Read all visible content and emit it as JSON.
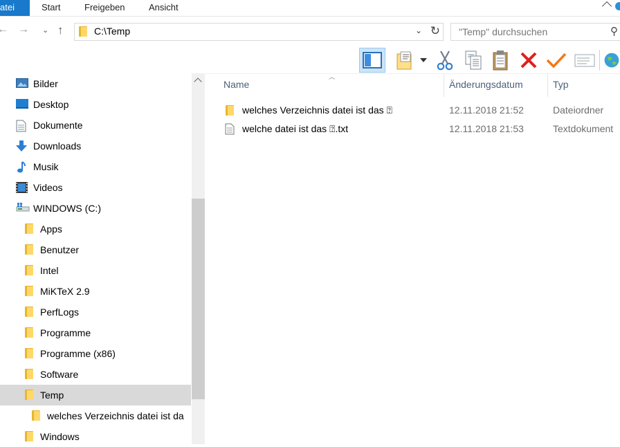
{
  "ribbon": {
    "tabs": [
      "Datei",
      "Start",
      "Freigeben",
      "Ansicht"
    ]
  },
  "address": {
    "path": "C:\\Temp",
    "search_placeholder": "\"Temp\" durchsuchen"
  },
  "toolbar": {
    "buttons": [
      "navigation-pane-icon",
      "properties-icon",
      "cut-icon",
      "copy-icon",
      "paste-icon",
      "delete-icon",
      "check-icon",
      "mail-icon",
      "globe-icon"
    ],
    "colors": {
      "active": "#cce4f7",
      "delete": "#e0201b",
      "check": "#f07a1b"
    }
  },
  "sidebar": {
    "items": [
      {
        "label": "Bilder",
        "icon": "pictures-icon"
      },
      {
        "label": "Desktop",
        "icon": "desktop-icon"
      },
      {
        "label": "Dokumente",
        "icon": "documents-icon"
      },
      {
        "label": "Downloads",
        "icon": "downloads-icon"
      },
      {
        "label": "Musik",
        "icon": "music-icon"
      },
      {
        "label": "Videos",
        "icon": "videos-icon"
      },
      {
        "label": "WINDOWS (C:)",
        "icon": "drive-icon"
      },
      {
        "label": "Apps",
        "icon": "folder-icon"
      },
      {
        "label": "Benutzer",
        "icon": "folder-icon"
      },
      {
        "label": "Intel",
        "icon": "folder-icon"
      },
      {
        "label": "MiKTeX 2.9",
        "icon": "folder-icon"
      },
      {
        "label": "PerfLogs",
        "icon": "folder-icon"
      },
      {
        "label": "Programme",
        "icon": "folder-icon"
      },
      {
        "label": "Programme (x86)",
        "icon": "folder-icon"
      },
      {
        "label": "Software",
        "icon": "folder-icon"
      },
      {
        "label": "Temp",
        "icon": "folder-icon",
        "selected": true
      },
      {
        "label": "welches Verzeichnis datei ist da",
        "icon": "folder-icon"
      },
      {
        "label": "Windows",
        "icon": "folder-icon"
      }
    ]
  },
  "content": {
    "columns": {
      "name": "Name",
      "date": "Änderungsdatum",
      "type": "Typ"
    },
    "rows": [
      {
        "name": "welches Verzeichnis datei ist das ⍰",
        "date": "12.11.2018 21:52",
        "type": "Dateiordner",
        "icon": "folder-icon"
      },
      {
        "name": "welche datei ist das ⍰.txt",
        "date": "12.11.2018 21:53",
        "type": "Textdokument",
        "icon": "text-file-icon"
      }
    ]
  }
}
